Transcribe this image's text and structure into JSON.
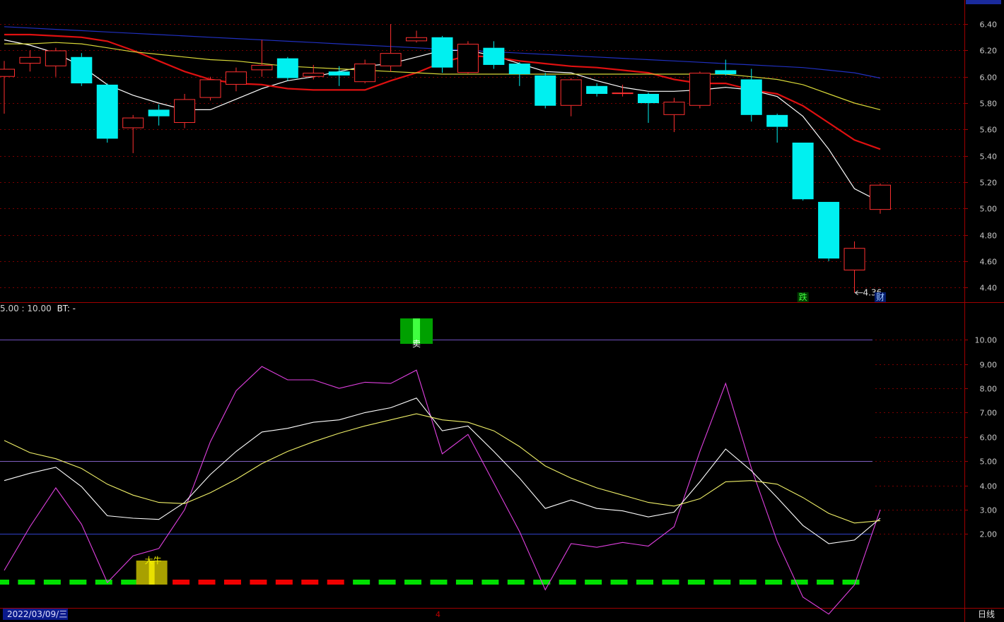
{
  "chart_data": [
    {
      "type": "candlestick",
      "title": "",
      "y_ticks": [
        "6.40",
        "6.20",
        "6.00",
        "5.80",
        "5.60",
        "5.40",
        "5.20",
        "5.00",
        "4.80",
        "4.60",
        "4.40"
      ],
      "ylim": [
        4.31,
        6.54
      ],
      "grid": true,
      "candles": [
        {
          "o": 6.0,
          "c": 6.06,
          "h": 6.12,
          "l": 5.72
        },
        {
          "o": 6.1,
          "c": 6.15,
          "h": 6.2,
          "l": 6.04
        },
        {
          "o": 6.08,
          "c": 6.2,
          "h": 6.22,
          "l": 6.0
        },
        {
          "o": 6.15,
          "c": 5.95,
          "h": 6.18,
          "l": 5.93
        },
        {
          "o": 5.94,
          "c": 5.53,
          "h": 5.95,
          "l": 5.5
        },
        {
          "o": 5.61,
          "c": 5.69,
          "h": 5.71,
          "l": 5.42
        },
        {
          "o": 5.75,
          "c": 5.7,
          "h": 5.79,
          "l": 5.63
        },
        {
          "o": 5.65,
          "c": 5.83,
          "h": 5.87,
          "l": 5.61
        },
        {
          "o": 5.84,
          "c": 5.98,
          "h": 6.0,
          "l": 5.82
        },
        {
          "o": 5.94,
          "c": 6.04,
          "h": 6.07,
          "l": 5.89
        },
        {
          "o": 6.05,
          "c": 6.09,
          "h": 6.28,
          "l": 6.0
        },
        {
          "o": 6.14,
          "c": 5.99,
          "h": 6.15,
          "l": 5.97
        },
        {
          "o": 6.0,
          "c": 6.03,
          "h": 6.09,
          "l": 5.98
        },
        {
          "o": 6.04,
          "c": 6.01,
          "h": 6.08,
          "l": 5.93
        },
        {
          "o": 5.96,
          "c": 6.1,
          "h": 6.13,
          "l": 5.95
        },
        {
          "o": 6.08,
          "c": 6.18,
          "h": 6.4,
          "l": 6.04
        },
        {
          "o": 6.27,
          "c": 6.3,
          "h": 6.35,
          "l": 6.26
        },
        {
          "o": 6.3,
          "c": 6.07,
          "h": 6.31,
          "l": 6.03
        },
        {
          "o": 6.03,
          "c": 6.25,
          "h": 6.27,
          "l": 6.02
        },
        {
          "o": 6.22,
          "c": 6.09,
          "h": 6.27,
          "l": 6.06
        },
        {
          "o": 6.1,
          "c": 6.02,
          "h": 6.11,
          "l": 5.93
        },
        {
          "o": 6.01,
          "c": 5.78,
          "h": 6.03,
          "l": 5.76
        },
        {
          "o": 5.78,
          "c": 5.98,
          "h": 5.99,
          "l": 5.7
        },
        {
          "o": 5.93,
          "c": 5.87,
          "h": 5.95,
          "l": 5.85
        },
        {
          "o": 5.87,
          "c": 5.88,
          "h": 5.94,
          "l": 5.85
        },
        {
          "o": 5.87,
          "c": 5.8,
          "h": 5.88,
          "l": 5.65
        },
        {
          "o": 5.71,
          "c": 5.81,
          "h": 5.84,
          "l": 5.58
        },
        {
          "o": 5.78,
          "c": 6.03,
          "h": 6.04,
          "l": 5.76
        },
        {
          "o": 6.05,
          "c": 6.02,
          "h": 6.13,
          "l": 6.01
        },
        {
          "o": 5.98,
          "c": 5.71,
          "h": 6.06,
          "l": 5.66
        },
        {
          "o": 5.71,
          "c": 5.62,
          "h": 5.72,
          "l": 5.5
        },
        {
          "o": 5.5,
          "c": 5.07,
          "h": 5.5,
          "l": 5.06
        },
        {
          "o": 5.05,
          "c": 4.62,
          "h": 5.05,
          "l": 4.6
        },
        {
          "o": 4.53,
          "c": 4.7,
          "h": 4.75,
          "l": 4.36
        },
        {
          "o": 4.99,
          "c": 5.18,
          "h": 5.19,
          "l": 4.96
        }
      ],
      "series": [
        {
          "color": "#ffffff",
          "values": [
            6.28,
            6.24,
            6.18,
            6.08,
            5.94,
            5.86,
            5.8,
            5.75,
            5.75,
            5.83,
            5.91,
            5.97,
            6.0,
            6.04,
            6.08,
            6.1,
            6.15,
            6.2,
            6.2,
            6.16,
            6.1,
            6.04,
            6.03,
            5.97,
            5.92,
            5.89,
            5.89,
            5.9,
            5.92,
            5.9,
            5.85,
            5.7,
            5.45,
            5.15,
            5.05
          ]
        },
        {
          "color": "#e01010",
          "values": [
            6.32,
            6.32,
            6.31,
            6.3,
            6.27,
            6.2,
            6.12,
            6.04,
            5.98,
            5.95,
            5.94,
            5.91,
            5.9,
            5.9,
            5.9,
            5.97,
            6.03,
            6.11,
            6.16,
            6.15,
            6.12,
            6.1,
            6.08,
            6.07,
            6.05,
            6.03,
            5.98,
            5.95,
            5.95,
            5.9,
            5.87,
            5.78,
            5.65,
            5.52,
            5.45
          ]
        },
        {
          "color": "#d8d838",
          "values": [
            6.25,
            6.25,
            6.26,
            6.25,
            6.22,
            6.19,
            6.17,
            6.15,
            6.13,
            6.12,
            6.1,
            6.08,
            6.07,
            6.06,
            6.05,
            6.04,
            6.03,
            6.02,
            6.02,
            6.02,
            6.02,
            6.02,
            6.02,
            6.02,
            6.02,
            6.02,
            6.02,
            6.02,
            6.02,
            6.0,
            5.98,
            5.94,
            5.87,
            5.8,
            5.75
          ]
        },
        {
          "color": "#2030c0",
          "values": [
            6.38,
            6.37,
            6.36,
            6.35,
            6.34,
            6.33,
            6.32,
            6.31,
            6.3,
            6.29,
            6.28,
            6.27,
            6.26,
            6.25,
            6.24,
            6.23,
            6.22,
            6.21,
            6.2,
            6.19,
            6.18,
            6.17,
            6.16,
            6.15,
            6.14,
            6.13,
            6.12,
            6.11,
            6.1,
            6.09,
            6.08,
            6.07,
            6.05,
            6.03,
            5.99
          ]
        }
      ],
      "annotations": {
        "low_label": "4.36",
        "tag1": "跌",
        "tag2": "财"
      }
    },
    {
      "type": "line",
      "title_params": "5.00 : 10.00",
      "title_bt": "BT: -",
      "y_ticks": [
        "10.00",
        "9.00",
        "8.00",
        "7.00",
        "6.00",
        "5.00",
        "4.00",
        "3.00",
        "2.00"
      ],
      "ylim": [
        -0.9,
        11.2
      ],
      "ref_lines": [
        10,
        5,
        2
      ],
      "series": [
        {
          "color": "#e040e0",
          "values": [
            0.5,
            2.3,
            3.9,
            2.4,
            0.0,
            1.1,
            1.4,
            3.0,
            5.8,
            7.9,
            8.9,
            8.35,
            8.35,
            8.0,
            8.25,
            8.2,
            8.75,
            5.3,
            6.1,
            4.1,
            2.1,
            -0.3,
            1.6,
            1.45,
            1.65,
            1.5,
            2.3,
            5.4,
            8.2,
            4.7,
            1.7,
            -0.6,
            -1.3,
            -0.1,
            3.0
          ]
        },
        {
          "color": "#ffffff",
          "values": [
            4.2,
            4.5,
            4.75,
            3.95,
            2.75,
            2.65,
            2.6,
            3.3,
            4.45,
            5.4,
            6.2,
            6.35,
            6.6,
            6.7,
            7.0,
            7.2,
            7.6,
            6.25,
            6.45,
            5.4,
            4.3,
            3.05,
            3.4,
            3.05,
            2.95,
            2.7,
            2.9,
            4.15,
            5.5,
            4.6,
            3.5,
            2.35,
            1.6,
            1.75,
            2.65
          ]
        },
        {
          "color": "#f0f068",
          "values": [
            5.85,
            5.35,
            5.1,
            4.7,
            4.05,
            3.6,
            3.3,
            3.25,
            3.7,
            4.25,
            4.9,
            5.4,
            5.8,
            6.15,
            6.45,
            6.7,
            6.95,
            6.7,
            6.6,
            6.25,
            5.6,
            4.8,
            4.3,
            3.9,
            3.6,
            3.3,
            3.15,
            3.45,
            4.15,
            4.2,
            4.05,
            3.5,
            2.85,
            2.45,
            2.55
          ]
        }
      ],
      "signal_bar": [
        "g",
        "g",
        "g",
        "g",
        "g",
        "g",
        "r",
        "r",
        "r",
        "r",
        "r",
        "r",
        "r",
        "r",
        "g",
        "g",
        "g",
        "g",
        "g",
        "g",
        "g",
        "g",
        "g",
        "g",
        "g",
        "g",
        "g",
        "g",
        "g",
        "g",
        "g",
        "g",
        "g",
        "g"
      ],
      "marker_sell": {
        "label": "卖",
        "index": 16
      },
      "marker_bull": {
        "label": "大牛",
        "index": 6
      },
      "colors": {
        "green": "#00e000",
        "red": "#f00000",
        "gold": "#a8a000",
        "sell_green": "#00a000"
      }
    }
  ],
  "footer": {
    "date": "2022/03/09/三",
    "cursor_label": "4",
    "period": "日线"
  }
}
